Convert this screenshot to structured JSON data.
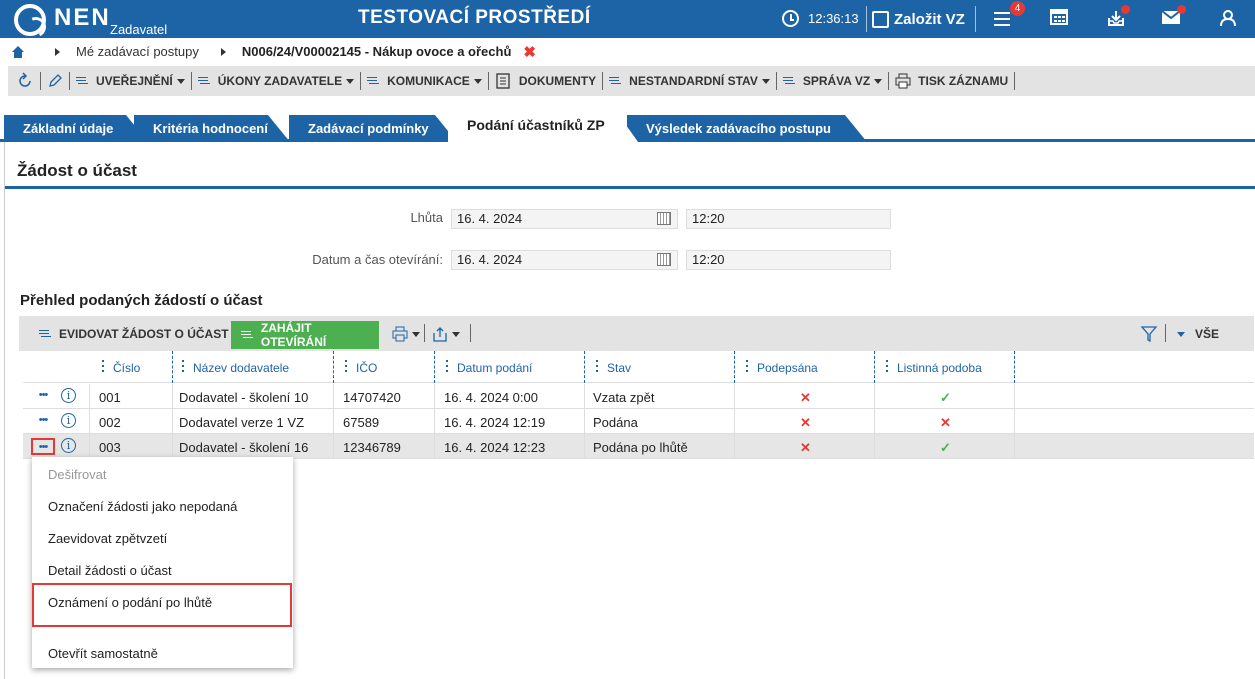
{
  "header": {
    "brand": "NEN",
    "brand_sub": "Zadavatel",
    "environment": "TESTOVACÍ PROSTŘEDÍ",
    "time": "12:36:13",
    "new_vz_label": "Založit VZ",
    "notifications_count": "4"
  },
  "breadcrumb": {
    "item1": "Mé zadávací postupy",
    "item2": "N006/24/V00002145 - Nákup ovoce a ořechů",
    "close": "✖"
  },
  "toolbar": {
    "uverejneni": "UVEŘEJNĚNÍ",
    "ukony": "ÚKONY ZADAVATELE",
    "komunikace": "KOMUNIKACE",
    "dokumenty": "DOKUMENTY",
    "nestandardni": "NESTANDARDNÍ STAV",
    "sprava": "SPRÁVA VZ",
    "tisk": "TISK ZÁZNAMU"
  },
  "tabs": [
    "Základní údaje",
    "Kritéria hodnocení",
    "Zadávací podmínky",
    "Podání účastníků ZP",
    "Výsledek zadávacího postupu"
  ],
  "section": {
    "title": "Žádost o účast",
    "lhuta_label": "Lhůta",
    "lhuta_date": "16. 4. 2024",
    "lhuta_time": "12:20",
    "otevirani_label": "Datum a čas otevírání:",
    "otevirani_date": "16. 4. 2024",
    "otevirani_time": "12:20"
  },
  "grid": {
    "title": "Přehled podaných žádostí o účast",
    "btn_evidovat": "EVIDOVAT ŽÁDOST O ÚČAST",
    "btn_zahajit": "ZAHÁJIT OTEVÍRÁNÍ",
    "filter_label": "VŠE",
    "columns": [
      "Číslo",
      "Název dodavatele",
      "IČO",
      "Datum podání",
      "Stav",
      "Podepsána",
      "Listinná podoba"
    ],
    "rows": [
      {
        "cislo": "001",
        "nazev": "Dodavatel - školení 10",
        "ico": "14707420",
        "datum": "16. 4. 2024 0:00",
        "stav": "Vzata zpět",
        "podepsana": "✕",
        "listinna": "✓"
      },
      {
        "cislo": "002",
        "nazev": "Dodavatel verze 1 VZ",
        "ico": "67589",
        "datum": "16. 4. 2024 12:19",
        "stav": "Podána",
        "podepsana": "✕",
        "listinna": "✕"
      },
      {
        "cislo": "003",
        "nazev": "Dodavatel - školení 16",
        "ico": "12346789",
        "datum": "16. 4. 2024 12:23",
        "stav": "Podána po lhůtě",
        "podepsana": "✕",
        "listinna": "✓"
      }
    ]
  },
  "context_menu": {
    "items": [
      "Dešifrovat",
      "Označení žádosti jako nepodaná",
      "Zaevidovat zpětvzetí",
      "Detail žádosti o účast",
      "Oznámení o podání po lhůtě",
      "Otevřít samostatně"
    ]
  }
}
